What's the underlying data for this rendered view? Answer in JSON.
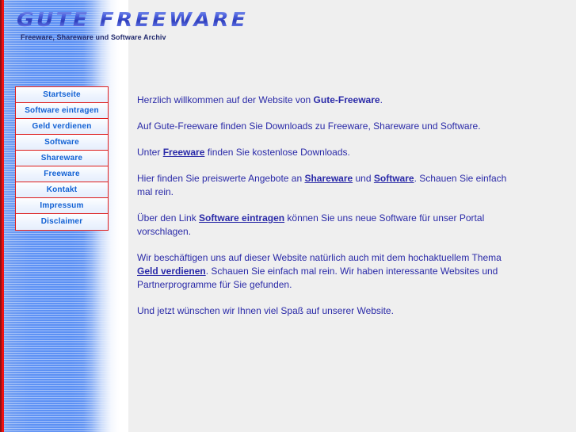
{
  "colors": {
    "accent_red": "#dd1c1c",
    "stripe_dark_red": "#8c1111",
    "stripe_red": "#ee1111",
    "nav_link_blue": "#1161d4",
    "body_text_blue": "#2a2aa8",
    "sidebar_blue": "#5a8ff4",
    "page_background": "#efefef"
  },
  "banner": {
    "wordmark": "GUTE FREEWARE",
    "tagline": "Freeware, Shareware und Software Archiv"
  },
  "nav": {
    "items": [
      {
        "label": "Startseite"
      },
      {
        "label": "Software eintragen"
      },
      {
        "label": "Geld verdienen"
      },
      {
        "label": "Software"
      },
      {
        "label": "Shareware"
      },
      {
        "label": "Freeware"
      },
      {
        "label": "Kontakt"
      },
      {
        "label": "Impressum"
      },
      {
        "label": "Disclaimer"
      }
    ]
  },
  "content": {
    "p1": {
      "a": "Herzlich willkommen auf der Website von ",
      "bold": "Gute-Freeware",
      "b": "."
    },
    "p2": {
      "a": "Auf Gute-Freeware finden Sie Downloads zu Freeware, Shareware und Software."
    },
    "p3": {
      "a": "Unter ",
      "link": "Freeware",
      "b": " finden Sie kostenlose Downloads."
    },
    "p4": {
      "a": "Hier finden Sie preiswerte Angebote an ",
      "link1": "Shareware",
      "b": " und ",
      "link2": "Software",
      "c": ". Schauen Sie einfach mal rein."
    },
    "p5": {
      "a": "Über den Link ",
      "link": "Software eintragen",
      "b": " können Sie uns neue Software für unser Portal vorschlagen."
    },
    "p6": {
      "a": "Wir beschäftigen uns auf dieser Website natürlich auch mit dem hochaktuellem Thema ",
      "link": "Geld verdienen",
      "b": ". Schauen Sie einfach mal rein. Wir haben interessante Websites und Partnerprogramme für Sie gefunden."
    },
    "p7": {
      "a": "Und jetzt wünschen wir Ihnen viel Spaß auf unserer Website."
    }
  }
}
